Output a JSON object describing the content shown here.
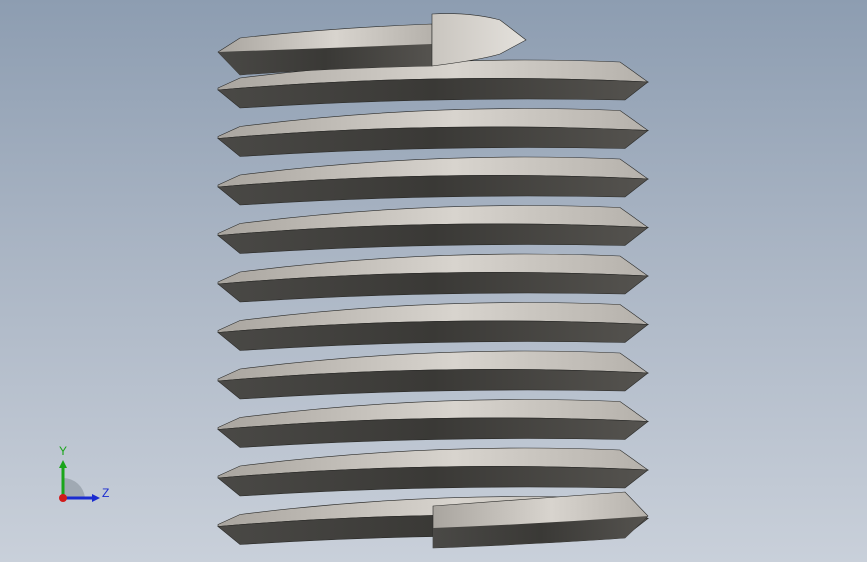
{
  "viewport": {
    "background_top": "#8d9db1",
    "background_bottom": "#c9d0da"
  },
  "model": {
    "part_name": "helical-coil-insert",
    "coil_count": 10,
    "colors": {
      "flank_light": "#d6d2cc",
      "flank_mid": "#a8a49e",
      "flank_dark": "#3e3d3a",
      "edge": "#2a2a28"
    }
  },
  "triad": {
    "y_label": "Y",
    "z_label": "Z",
    "y_color": "#1aa51a",
    "z_color": "#1a2bd0",
    "x_color": "#d01a1a"
  }
}
